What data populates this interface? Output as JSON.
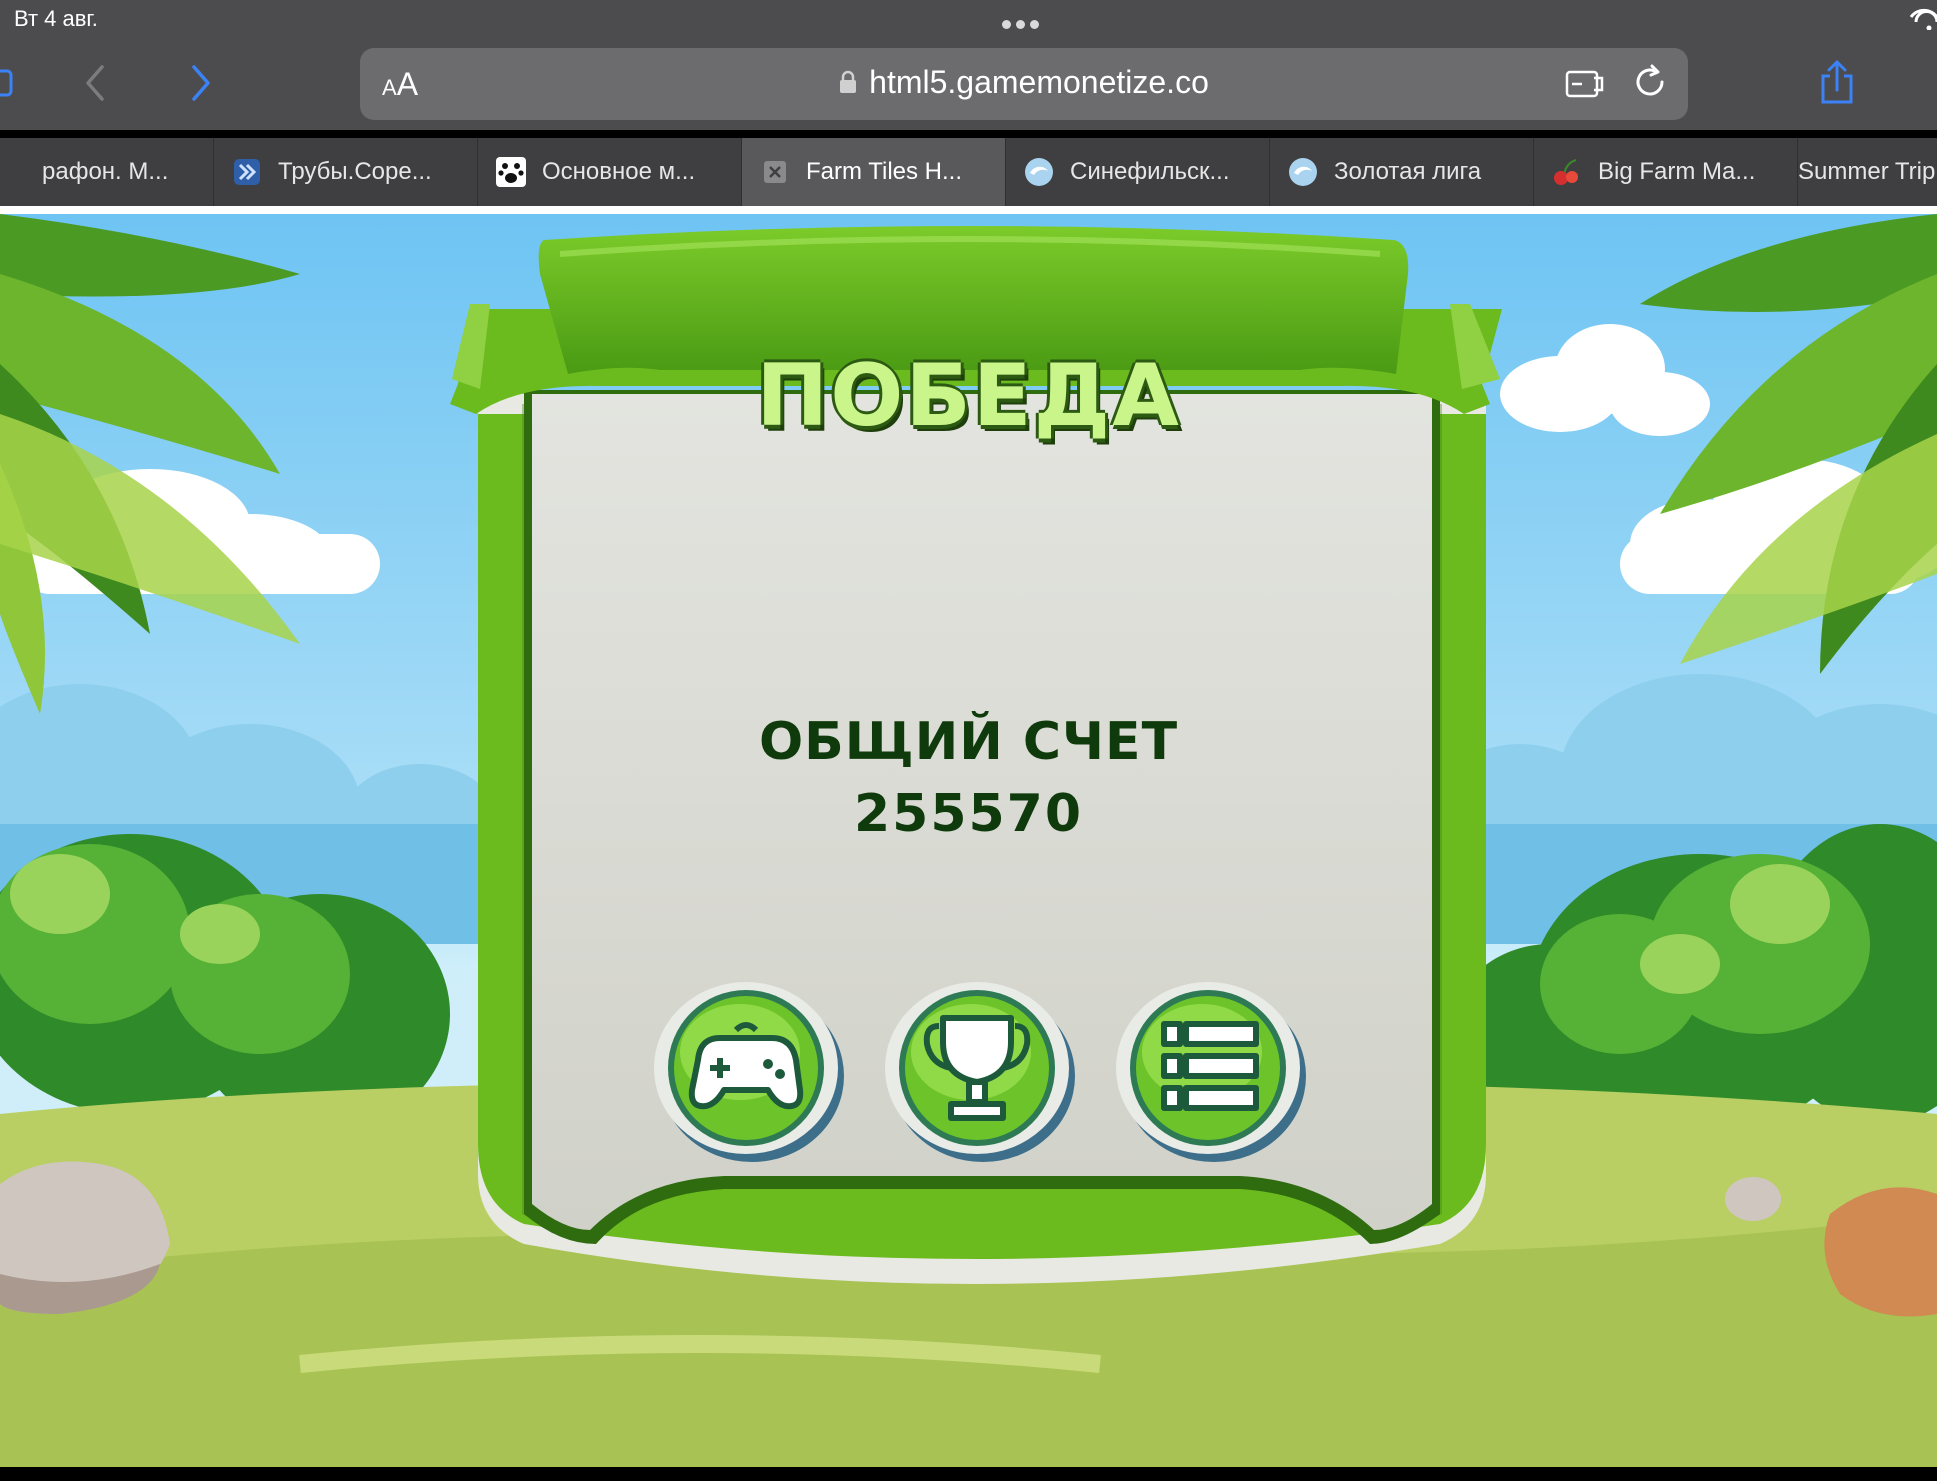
{
  "status": {
    "date": "Вт 4 авг."
  },
  "browser": {
    "aa_small": "A",
    "aa_large": "A",
    "url": "html5.gamemonetize.co",
    "tabs": [
      {
        "label": "рафон. М...",
        "active": false
      },
      {
        "label": "Трубы.Соре...",
        "active": false
      },
      {
        "label": "Основное м...",
        "active": false
      },
      {
        "label": "Farm Tiles H...",
        "active": true
      },
      {
        "label": "Синефильск...",
        "active": false
      },
      {
        "label": "Золотая лига",
        "active": false
      },
      {
        "label": "Big Farm Ma...",
        "active": false
      },
      {
        "label": "Summer Trip",
        "active": false
      }
    ]
  },
  "game": {
    "title": "ПОБЕДА",
    "score_label": "ОБЩИЙ СЧЕТ",
    "score_value": "255570",
    "buttons": [
      {
        "icon": "gamepad-icon"
      },
      {
        "icon": "trophy-icon"
      },
      {
        "icon": "list-icon"
      }
    ]
  },
  "colors": {
    "panel_green": "#6cbb1e",
    "panel_inner": "#dedfd8",
    "title_text": "#c9f58a",
    "score_text": "#0f3a0b",
    "browser_chrome": "#4c4c4e"
  }
}
